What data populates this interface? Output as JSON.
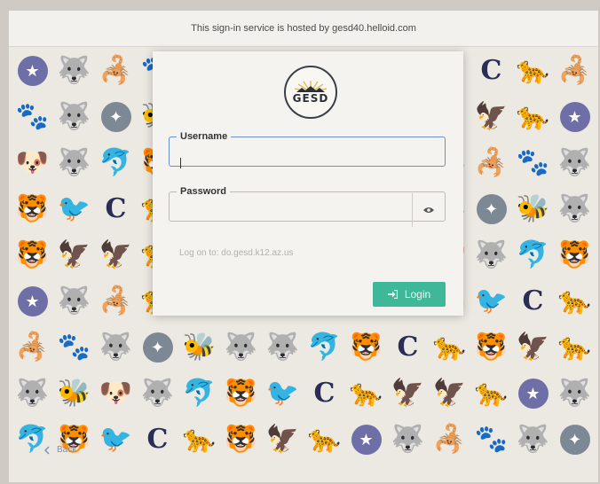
{
  "banner": {
    "text": "This sign-in service is hosted by gesd40.helloid.com"
  },
  "logo": {
    "text": "GESD"
  },
  "form": {
    "username_label": "Username",
    "username_value": "",
    "password_label": "Password",
    "password_value": "",
    "show_password_icon": "eye-icon",
    "logon_text": "Log on to: do.gesd.k12.az.us",
    "login_label": "Login",
    "login_icon": "sign-in-icon"
  },
  "footer": {
    "back_label": "Back",
    "back_icon": "chevron-left-icon"
  },
  "colors": {
    "accent": "#3fb89a",
    "focus": "#6b8fc9",
    "link": "#7a90b8"
  }
}
